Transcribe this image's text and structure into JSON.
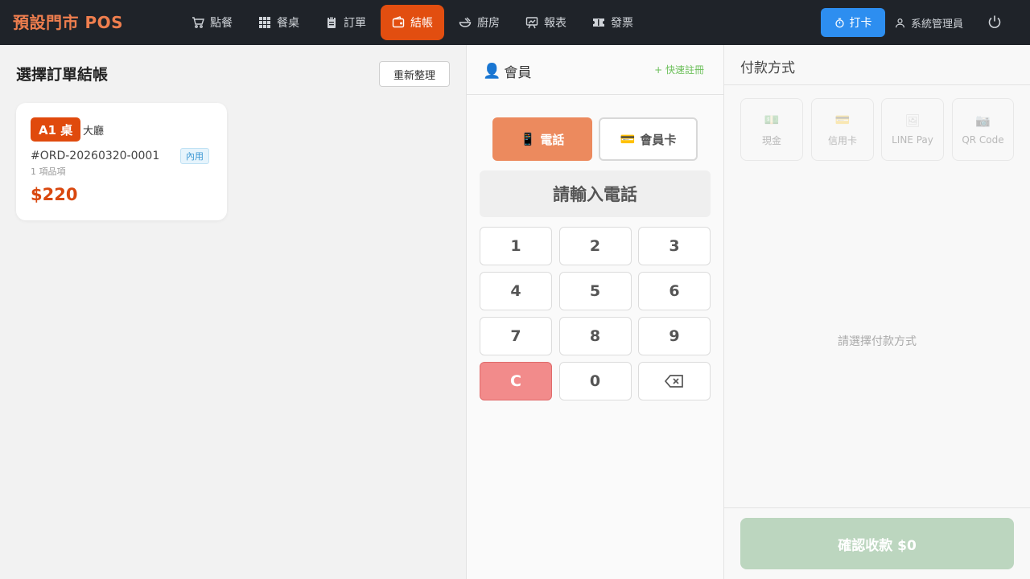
{
  "brand": "預設門市 POS",
  "nav": {
    "items": [
      {
        "label": "點餐",
        "icon": "cart-icon"
      },
      {
        "label": "餐桌",
        "icon": "grid-icon"
      },
      {
        "label": "訂單",
        "icon": "clipboard-icon"
      },
      {
        "label": "結帳",
        "icon": "wallet-icon",
        "active": true
      },
      {
        "label": "廚房",
        "icon": "bowl-icon"
      },
      {
        "label": "報表",
        "icon": "presentation-icon"
      },
      {
        "label": "發票",
        "icon": "ticket-icon"
      }
    ],
    "clock_label": "打卡",
    "user_label": "系統管理員"
  },
  "orders_panel": {
    "title": "選擇訂單結帳",
    "refresh_label": "重新整理",
    "orders": [
      {
        "table": "A1 桌",
        "area": "大廳",
        "order_no": "#ORD-20260320-0001",
        "type_badge": "內用",
        "item_count": "1 項品項",
        "total": "$220"
      }
    ]
  },
  "member_panel": {
    "title": "會員",
    "title_icon": "👤",
    "quick_register": "+ 快速註冊",
    "modes": [
      {
        "label": "電話",
        "icon": "📱"
      },
      {
        "label": "會員卡",
        "icon": "💳"
      }
    ],
    "display_placeholder": "請輸入電話",
    "keys": [
      "1",
      "2",
      "3",
      "4",
      "5",
      "6",
      "7",
      "8",
      "9",
      "C",
      "0"
    ]
  },
  "payment_panel": {
    "title": "付款方式",
    "methods": [
      {
        "label": "現金",
        "icon": "💵"
      },
      {
        "label": "信用卡",
        "icon": "💳"
      },
      {
        "label": "LINE Pay",
        "icon": "🖼"
      },
      {
        "label": "QR Code",
        "icon": "📷"
      }
    ],
    "hint": "請選擇付款方式",
    "confirm_label": "確認收款 $0"
  },
  "colors": {
    "topbar_bg": "#1f2329",
    "brand": "#ef7e4e",
    "active_nav": "#e24e10",
    "clock_btn": "#2d8ef0",
    "order_tag": "#e04a0d",
    "phone_mode": "#ec8a5e",
    "clear_key": "#f28b8b",
    "confirm_btn": "#bcd6bf"
  }
}
